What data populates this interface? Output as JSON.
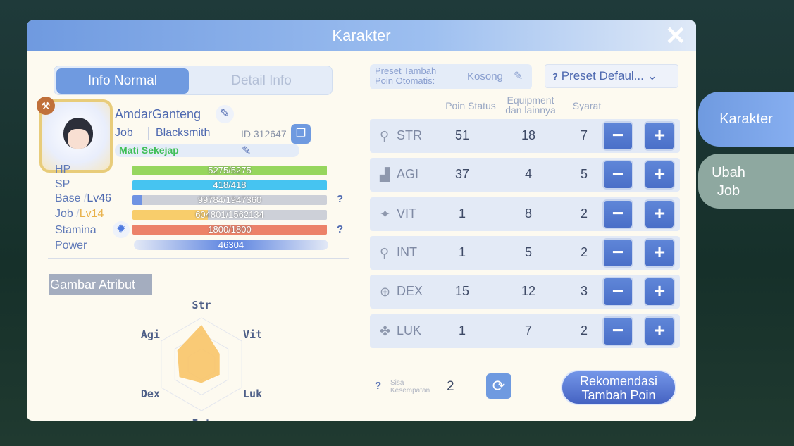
{
  "header": {
    "title": "Karakter",
    "close_icon": "close-icon"
  },
  "tabs": [
    {
      "label": "Info Normal",
      "active": true
    },
    {
      "label": "Detail Info",
      "active": false
    }
  ],
  "profile": {
    "name": "AmdarGanteng",
    "job_label": "Job",
    "job": "Blacksmith",
    "id": "ID 312647",
    "title": "Mati Sekejap"
  },
  "bars": {
    "hp": {
      "label": "HP",
      "value": "5275/5275",
      "fraction": 1,
      "color": "#96d65e"
    },
    "sp": {
      "label": "SP",
      "value": "418/418",
      "fraction": 1,
      "color": "#46c4f1"
    },
    "base": {
      "label": "Base",
      "level": "Lv46",
      "value": "99784/1947360",
      "fraction": 0.051,
      "color": "#6f93e3"
    },
    "job": {
      "label": "Job",
      "level": "Lv14",
      "value": "604801/1562134",
      "fraction": 0.387,
      "color": "#f8cd6b"
    },
    "stamina": {
      "label": "Stamina",
      "value": "1800/1800",
      "fraction": 1,
      "color": "#ec8269"
    },
    "power": {
      "label": "Power",
      "value": "46304"
    }
  },
  "radar": {
    "button": "Gambar Atribut",
    "axes": [
      "Str",
      "Vit",
      "Luk",
      "Int",
      "Dex",
      "Agi"
    ],
    "levels": [
      0.85,
      0.45,
      0.45,
      0.4,
      0.55,
      0.6
    ],
    "fill": "#f8c468"
  },
  "preset": {
    "label": "Preset Tambah Poin Otomatis:",
    "value": "Kosong",
    "dropdown": "Preset Defaul...",
    "help": "?"
  },
  "columns": [
    "Poin Status",
    "Equipment dan lainnya",
    "Syarat"
  ],
  "stats": [
    {
      "name": "STR",
      "icon": "str-icon",
      "points": "51",
      "equipment": "18",
      "requirement": "7"
    },
    {
      "name": "AGI",
      "icon": "agi-icon",
      "points": "37",
      "equipment": "4",
      "requirement": "5"
    },
    {
      "name": "VIT",
      "icon": "vit-icon",
      "points": "1",
      "equipment": "8",
      "requirement": "2"
    },
    {
      "name": "INT",
      "icon": "int-icon",
      "points": "1",
      "equipment": "5",
      "requirement": "2"
    },
    {
      "name": "DEX",
      "icon": "dex-icon",
      "points": "15",
      "equipment": "12",
      "requirement": "3"
    },
    {
      "name": "LUK",
      "icon": "luk-icon",
      "points": "1",
      "equipment": "7",
      "requirement": "2"
    }
  ],
  "footer": {
    "help": "?",
    "remaining_label": "Sisa Kesempatan",
    "remaining": "2",
    "recommend": "Rekomendasi Tambah Poin"
  },
  "side_tabs": [
    {
      "label": "Karakter",
      "active": true
    },
    {
      "label": "Ubah Job",
      "active": false
    }
  ],
  "buttons": {
    "minus": "−",
    "plus": "+"
  }
}
